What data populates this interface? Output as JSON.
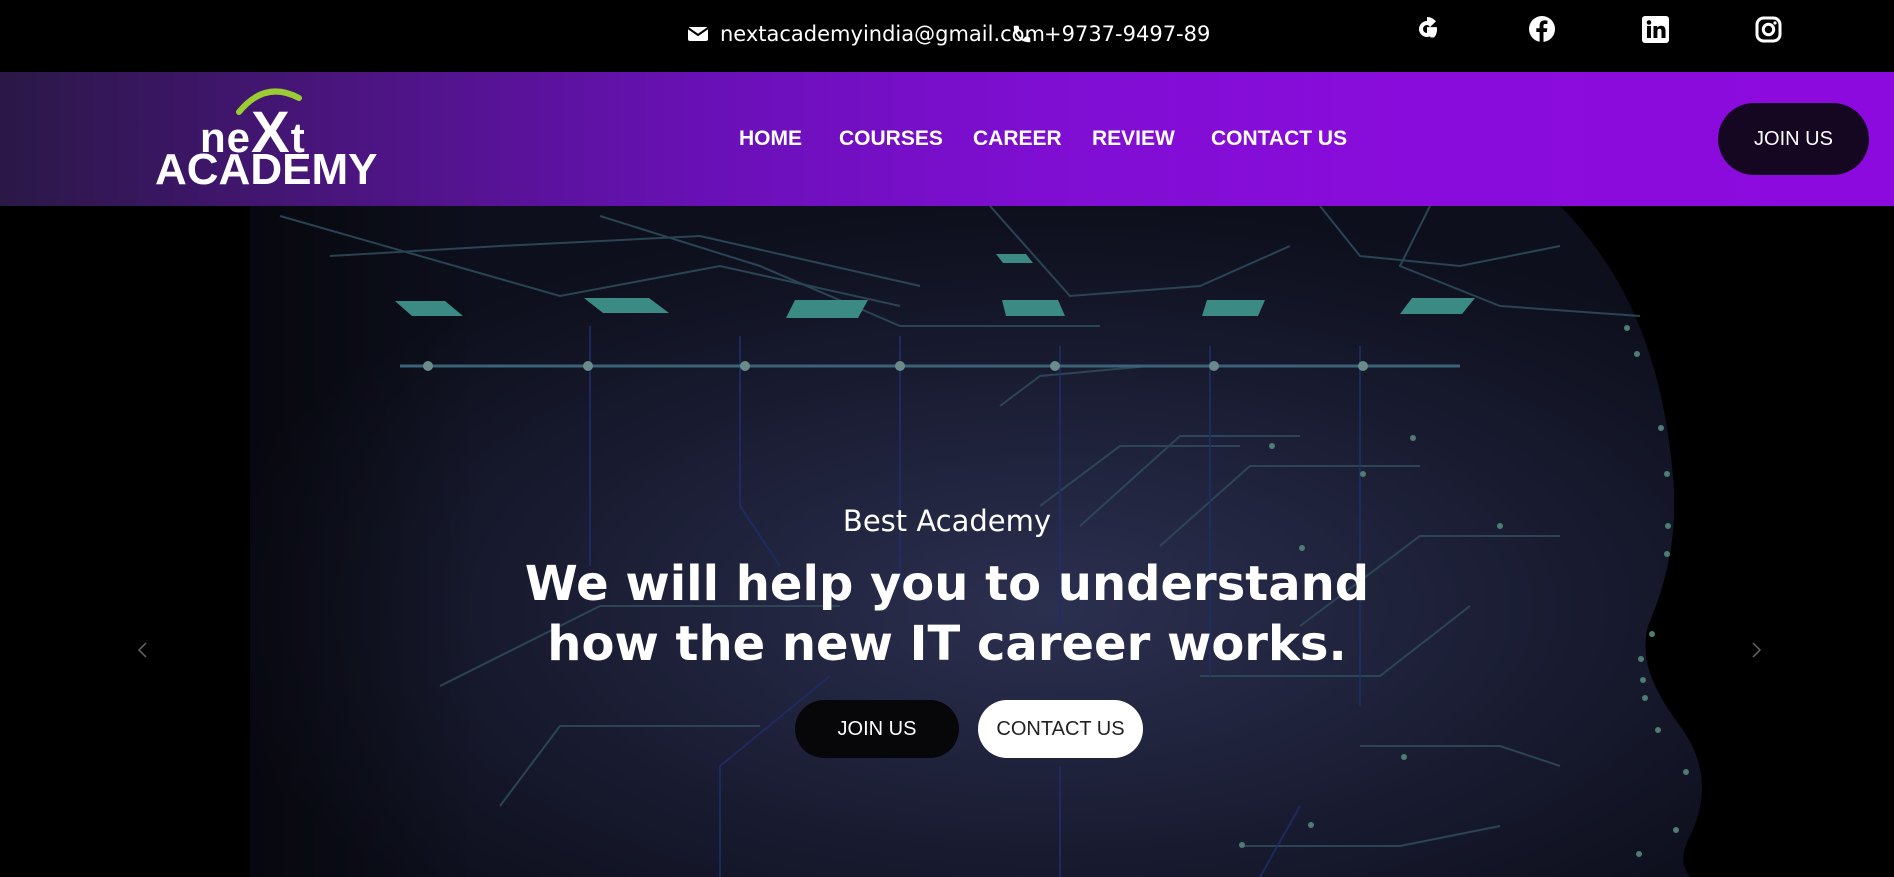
{
  "contact": {
    "email": "nextacademyindia@gmail.com",
    "phone": "+9737-9497-89"
  },
  "social": [
    "google-icon",
    "facebook-icon",
    "linkedin-icon",
    "instagram-icon"
  ],
  "logo": {
    "top": "NEXT",
    "bottom": "ACADEMY"
  },
  "nav": {
    "items": [
      "HOME",
      "COURSES",
      "CAREER",
      "REVIEW",
      "CONTACT US"
    ],
    "cta": "JOIN US"
  },
  "hero": {
    "kicker": "Best Academy",
    "headline_line1": "We will help you to understand",
    "headline_line2": "how the new IT career works.",
    "primary_button": "JOIN US",
    "secondary_button": "CONTACT US"
  },
  "colors": {
    "nav_gradient_start": "#2a1846",
    "nav_gradient_end": "#8c0ade",
    "join_button": "#150621",
    "accent_arc": "#9acd32"
  }
}
